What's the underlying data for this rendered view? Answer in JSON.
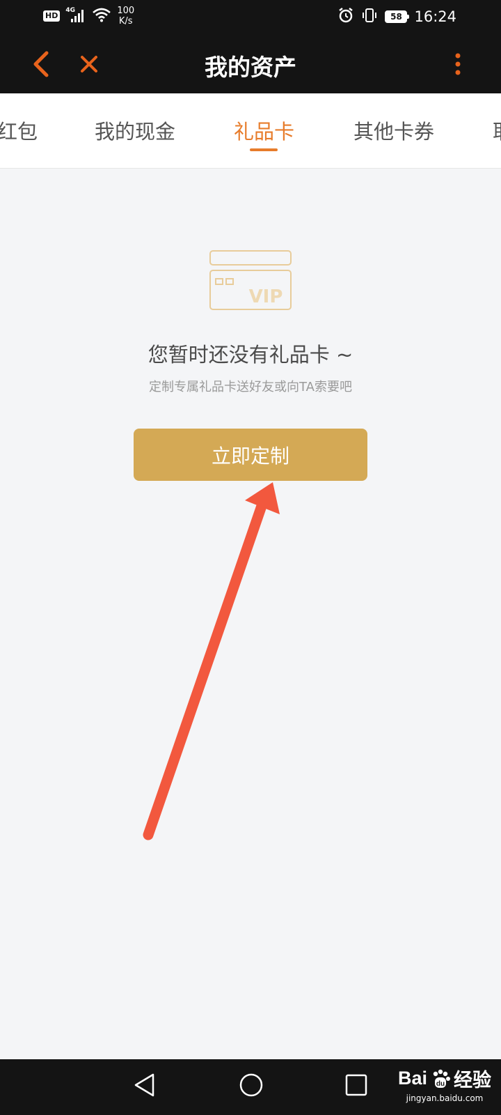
{
  "status_bar": {
    "hd": "HD",
    "network": "4G",
    "speed_value": "100",
    "speed_unit": "K/s",
    "battery": "58",
    "time": "16:24"
  },
  "app_bar": {
    "title": "我的资产",
    "icons": [
      "back-icon",
      "close-icon",
      "more-vert-icon"
    ],
    "accent": "#e8631c"
  },
  "tabs": [
    {
      "label": "红包",
      "active": false
    },
    {
      "label": "我的现金",
      "active": false
    },
    {
      "label": "礼品卡",
      "active": true
    },
    {
      "label": "其他卡券",
      "active": false
    },
    {
      "label": "耶",
      "active": false
    }
  ],
  "empty_state": {
    "icon": "vip-card-icon",
    "icon_text": "VIP",
    "title": "您暂时还没有礼品卡 ~",
    "subtitle": "定制专属礼品卡送好友或向TA索要吧",
    "button_label": "立即定制"
  },
  "annotation": {
    "icon": "red-arrow-annotation",
    "color": "#f2583e"
  },
  "nav_bar": {
    "icons": [
      "back-triangle-icon",
      "home-circle-icon",
      "recents-square-icon"
    ]
  },
  "watermark": {
    "logo_text_1": "Bai",
    "logo_text_2": "du",
    "logo_text_3": "经验",
    "url": "jingyan.baidu.com"
  },
  "colors": {
    "dark_bar": "#141414",
    "tab_active": "#e77c2b",
    "button": "#d4a955",
    "background": "#f4f5f7",
    "icon_outline": "#e8cc9a"
  }
}
